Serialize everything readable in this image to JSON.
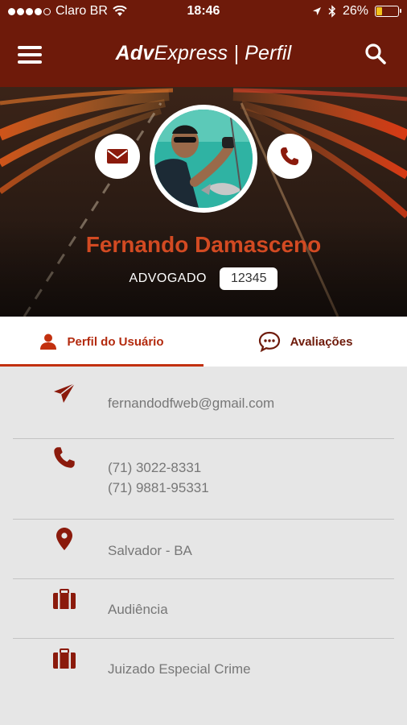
{
  "status_bar": {
    "carrier": "Claro BR",
    "time": "18:46",
    "battery_percent": "26%",
    "battery_level": 0.26,
    "icons": [
      "signal-dots-icon",
      "wifi-icon",
      "location-arrow-icon",
      "bluetooth-icon",
      "battery-icon"
    ]
  },
  "nav": {
    "title_brand": "Adv",
    "title_rest": "Express | Perfil",
    "menu_icon": "hamburger-menu-icon",
    "search_icon": "search-icon"
  },
  "profile": {
    "name": "Fernando Damasceno",
    "role": "ADVOGADO",
    "oab_number": "12345",
    "actions": [
      "mail-icon",
      "phone-icon"
    ]
  },
  "tabs": [
    {
      "label": "Perfil do Usuário",
      "icon": "user-icon",
      "active": true
    },
    {
      "label": "Avaliações",
      "icon": "chat-bubble-icon",
      "active": false
    }
  ],
  "details": {
    "email": "fernandodfweb@gmail.com",
    "phones": [
      "(71) 3022-8331",
      "(71) 9881-95331"
    ],
    "location": "Salvador - BA",
    "practice_area": "Audiência",
    "court": "Juizado Especial Crime"
  },
  "colors": {
    "header_bg": "#6e1a0a",
    "accent": "#c2300f",
    "name_color": "#d24a22",
    "icon_color": "#8b1a0c",
    "list_bg": "#e6e6e6",
    "text_gray": "#777777"
  }
}
